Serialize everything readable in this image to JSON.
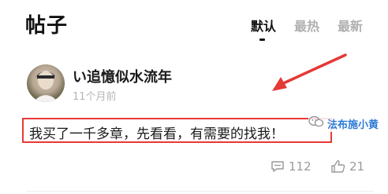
{
  "header": {
    "title": "帖子",
    "tabs": [
      {
        "label": "默认",
        "active": true
      },
      {
        "label": "最热",
        "active": false
      },
      {
        "label": "最新",
        "active": false
      }
    ]
  },
  "post": {
    "avatar_icon": "user-avatar",
    "username": "い追憶似水流年",
    "timestamp": "11个月前",
    "content": "我买了一千多章，先看看，有需要的找我！",
    "comments_count": "112",
    "likes_count": "21"
  },
  "watermark": {
    "text": "法布施小黄"
  },
  "colors": {
    "highlight": "#e53935",
    "muted": "#b0b0b0",
    "watermark": "#2e7bd6"
  }
}
